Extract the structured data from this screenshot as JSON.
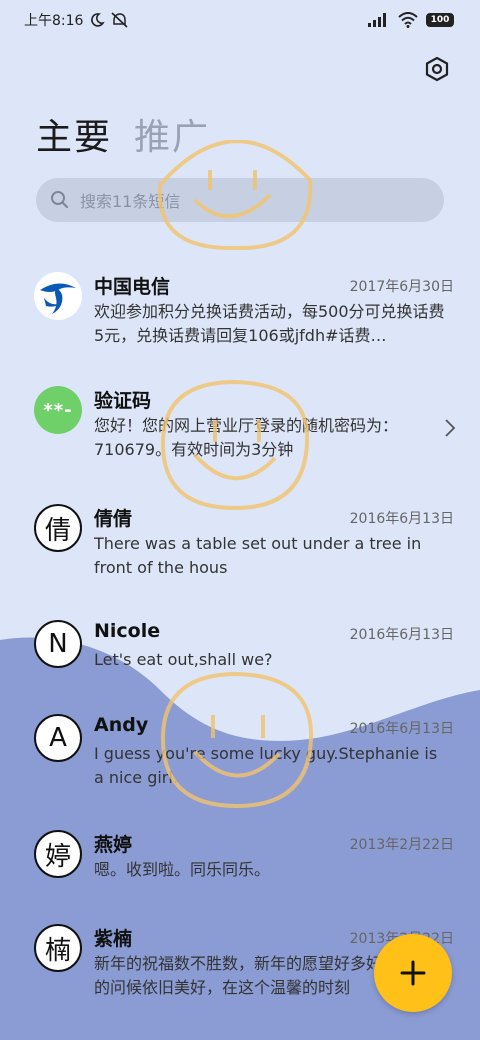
{
  "status_bar": {
    "time": "上午8:16",
    "moon_icon": "moon-icon",
    "mute_icon": "mute-icon",
    "signal_icon": "signal-icon",
    "wifi_icon": "wifi-icon",
    "battery": "100"
  },
  "header": {
    "settings_icon": "settings-hex-icon",
    "tabs": [
      {
        "label": "主要",
        "active": true
      },
      {
        "label": "推广",
        "active": false
      }
    ]
  },
  "search": {
    "placeholder": "搜索11条短信"
  },
  "messages": [
    {
      "sender": "中国电信",
      "date": "2017年6月30日",
      "preview": "欢迎参加积分兑换话费活动，每500分可兑换话费5元，兑换话费请回复106或jfdh#话费…",
      "avatar": "telecom-logo"
    },
    {
      "sender": "验证码",
      "date": "",
      "preview": "您好！您的网上营业厅登录的随机密码为：710679。有效时间为3分钟",
      "avatar": "**-"
    },
    {
      "sender": "倩倩",
      "date": "2016年6月13日",
      "preview": "There was a table set out under a tree in front of the hous",
      "avatar": "倩"
    },
    {
      "sender": "Nicole",
      "date": "2016年6月13日",
      "preview": "Let's eat out,shall we?",
      "avatar": "N"
    },
    {
      "sender": "Andy",
      "date": "2016年6月13日",
      "preview": "I guess you're some lucky guy.Stephanie is a nice girl.",
      "avatar": "A"
    },
    {
      "sender": "燕婷",
      "date": "2013年2月22日",
      "preview": "嗯。收到啦。同乐同乐。",
      "avatar": "婷"
    },
    {
      "sender": "紫楠",
      "date": "2013年2月22日",
      "preview": "新年的祝福数不胜数，新年的愿望好多好多，新年的问候依旧美好，在这个温馨的时刻",
      "avatar": "楠"
    }
  ],
  "fab": {
    "icon": "plus-icon"
  },
  "colors": {
    "background_top": "#dde6f8",
    "background_wave": "#8b9bd4",
    "accent_fab": "#ffc017",
    "avatar_green": "#6fd06a",
    "smiley": "#f2c36b"
  }
}
